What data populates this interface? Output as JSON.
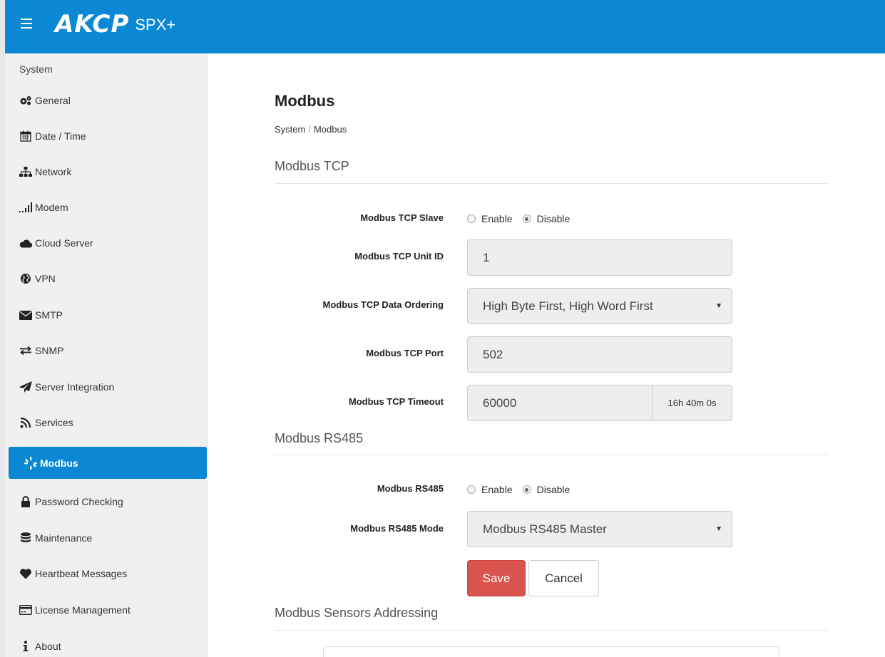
{
  "header": {
    "brand": "AKCP",
    "product": "SPX+"
  },
  "sidebar": {
    "section": "System",
    "items": [
      {
        "label": "General",
        "icon": "gears-icon"
      },
      {
        "label": "Date / Time",
        "icon": "calendar-icon"
      },
      {
        "label": "Network",
        "icon": "sitemap-icon"
      },
      {
        "label": "Modem",
        "icon": "signal-bars-icon"
      },
      {
        "label": "Cloud Server",
        "icon": "cloud-icon"
      },
      {
        "label": "VPN",
        "icon": "globe-icon"
      },
      {
        "label": "SMTP",
        "icon": "envelope-icon"
      },
      {
        "label": "SNMP",
        "icon": "exchange-icon"
      },
      {
        "label": "Server Integration",
        "icon": "paper-plane-icon"
      },
      {
        "label": "Services",
        "icon": "rss-icon"
      },
      {
        "label": "Modbus",
        "icon": "modbus-icon",
        "active": true
      },
      {
        "label": "Password Checking",
        "icon": "lock-icon"
      },
      {
        "label": "Maintenance",
        "icon": "database-icon"
      },
      {
        "label": "Heartbeat Messages",
        "icon": "heart-icon"
      },
      {
        "label": "License Management",
        "icon": "credit-card-icon"
      },
      {
        "label": "About",
        "icon": "info-icon"
      }
    ]
  },
  "main": {
    "title": "Modbus",
    "breadcrumb": {
      "parent": "System",
      "separator": "/",
      "current": "Modbus"
    },
    "tcp": {
      "section_title": "Modbus TCP",
      "slave_label": "Modbus TCP Slave",
      "slave_options": [
        "Enable",
        "Disable"
      ],
      "slave_selected": "Disable",
      "unit_id_label": "Modbus TCP Unit ID",
      "unit_id_value": "1",
      "ordering_label": "Modbus TCP Data Ordering",
      "ordering_value": "High Byte First, High Word First",
      "port_label": "Modbus TCP Port",
      "port_value": "502",
      "timeout_label": "Modbus TCP Timeout",
      "timeout_value": "60000",
      "timeout_readable": "16h 40m 0s"
    },
    "rs485": {
      "section_title": "Modbus RS485",
      "enable_label": "Modbus RS485",
      "enable_options": [
        "Enable",
        "Disable"
      ],
      "enable_selected": "Disable",
      "mode_label": "Modbus RS485 Mode",
      "mode_value": "Modbus RS485 Master"
    },
    "buttons": {
      "save": "Save",
      "cancel": "Cancel"
    },
    "addressing": {
      "section_title": "Modbus Sensors Addressing"
    }
  },
  "colors": {
    "accent": "#0a88d4",
    "save": "#d9534f"
  }
}
